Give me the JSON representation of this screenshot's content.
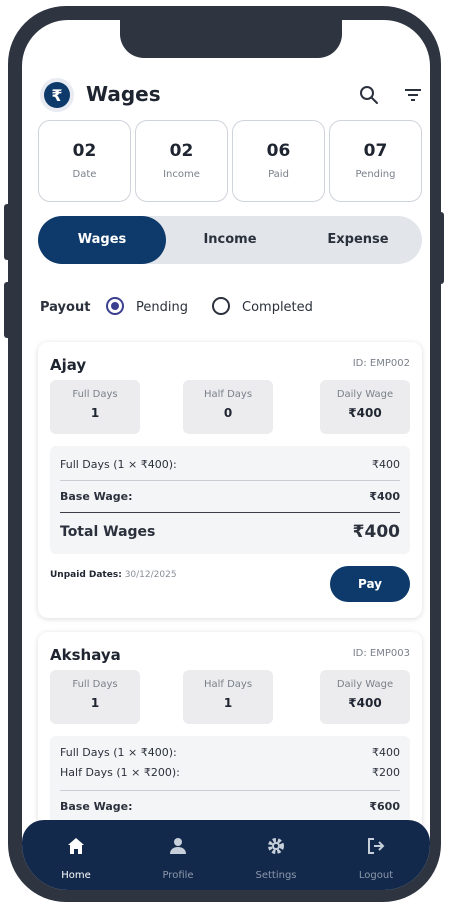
{
  "header": {
    "title": "Wages",
    "logo_symbol": "₹"
  },
  "stats": [
    {
      "value": "02",
      "label": "Date"
    },
    {
      "value": "02",
      "label": "Income"
    },
    {
      "value": "06",
      "label": "Paid"
    },
    {
      "value": "07",
      "label": "Pending"
    }
  ],
  "tabs": [
    {
      "label": "Wages",
      "active": true
    },
    {
      "label": "Income",
      "active": false
    },
    {
      "label": "Expense",
      "active": false
    }
  ],
  "payout": {
    "label": "Payout",
    "options": [
      {
        "label": "Pending",
        "selected": true
      },
      {
        "label": "Completed",
        "selected": false
      }
    ]
  },
  "employees": [
    {
      "name": "Ajay",
      "id": "ID: EMP002",
      "stats": [
        {
          "label": "Full Days",
          "value": "1"
        },
        {
          "label": "Half Days",
          "value": "0"
        },
        {
          "label": "Daily Wage",
          "value": "₹400"
        }
      ],
      "rows": [
        {
          "label": "Full Days (1 × ₹400):",
          "value": "₹400"
        }
      ],
      "base_label": "Base Wage:",
      "base_value": "₹400",
      "total_label": "Total Wages",
      "total_value": "₹400",
      "unpaid_label": "Unpaid Dates:",
      "unpaid_dates": "30/12/2025",
      "pay_label": "Pay"
    },
    {
      "name": "Akshaya",
      "id": "ID: EMP003",
      "stats": [
        {
          "label": "Full Days",
          "value": "1"
        },
        {
          "label": "Half Days",
          "value": "1"
        },
        {
          "label": "Daily Wage",
          "value": "₹400"
        }
      ],
      "rows": [
        {
          "label": "Full Days (1 × ₹400):",
          "value": "₹400"
        },
        {
          "label": "Half Days (1 × ₹200):",
          "value": "₹200"
        }
      ],
      "base_label": "Base Wage:",
      "base_value": "₹600"
    }
  ],
  "nav": [
    {
      "label": "Home",
      "icon": "home-icon",
      "active": true
    },
    {
      "label": "Profile",
      "icon": "person-icon",
      "active": false
    },
    {
      "label": "Settings",
      "icon": "gear-icon",
      "active": false
    },
    {
      "label": "Logout",
      "icon": "logout-icon",
      "active": false
    }
  ],
  "colors": {
    "primary": "#0d3a6b",
    "nav_bg": "#13294b",
    "frame": "#2e3440"
  }
}
